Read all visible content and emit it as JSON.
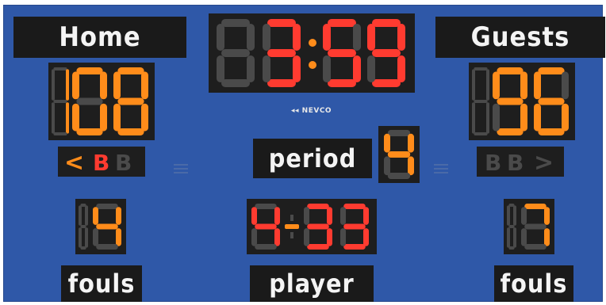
{
  "home": {
    "label": "Home",
    "score": "108",
    "bonus_arrow": "<",
    "bonus": "B",
    "fouls": "4",
    "fouls_label": "fouls"
  },
  "guests": {
    "label": "Guests",
    "score": "96",
    "bonus_arrow": ">",
    "fouls": "7",
    "fouls_label": "fouls"
  },
  "clock": {
    "minutes": "3",
    "seconds": "59"
  },
  "period": {
    "label": "period",
    "value": "4"
  },
  "player": {
    "number": "4",
    "fouls": "33",
    "label": "player"
  },
  "brand": "NEVCO",
  "colors": {
    "board": "#2f58a8",
    "lit_orange": "#ff8c1a",
    "lit_red": "#ff3b30",
    "unlit": "#4a4a4a",
    "plate": "#1a1a1a"
  }
}
